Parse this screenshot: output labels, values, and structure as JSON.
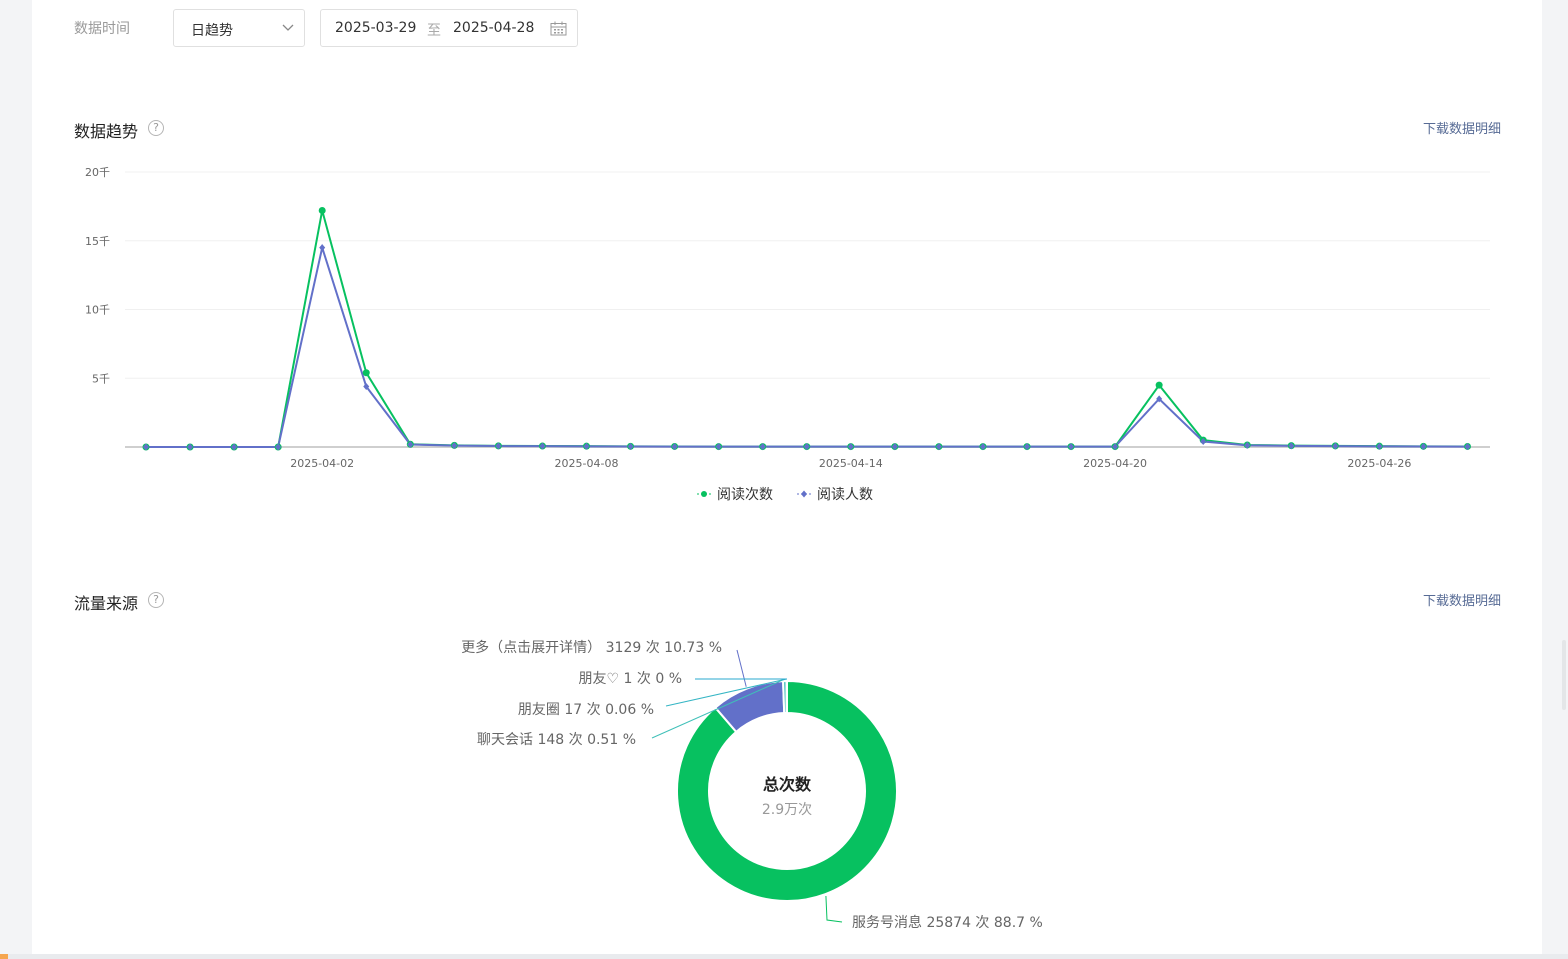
{
  "filters": {
    "label": "数据时间",
    "mode": "日趋势",
    "date_start": "2025-03-29",
    "date_sep": "至",
    "date_end": "2025-04-28"
  },
  "trend": {
    "title": "数据趋势",
    "help": "?",
    "download": "下载数据明细"
  },
  "source": {
    "title": "流量来源",
    "help": "?",
    "download": "下载数据明细",
    "center_title": "总次数",
    "center_value": "2.9万次"
  },
  "chart_data": [
    {
      "type": "line",
      "y_tick_labels": [
        "5千",
        "10千",
        "15千",
        "20千"
      ],
      "y_ticks": [
        5000,
        10000,
        15000,
        20000
      ],
      "ylim": [
        0,
        20000
      ],
      "x": [
        "2025-03-29",
        "2025-03-30",
        "2025-03-31",
        "2025-04-01",
        "2025-04-02",
        "2025-04-03",
        "2025-04-04",
        "2025-04-05",
        "2025-04-06",
        "2025-04-07",
        "2025-04-08",
        "2025-04-09",
        "2025-04-10",
        "2025-04-11",
        "2025-04-12",
        "2025-04-13",
        "2025-04-14",
        "2025-04-15",
        "2025-04-16",
        "2025-04-17",
        "2025-04-18",
        "2025-04-19",
        "2025-04-20",
        "2025-04-21",
        "2025-04-22",
        "2025-04-23",
        "2025-04-24",
        "2025-04-25",
        "2025-04-26",
        "2025-04-27",
        "2025-04-28"
      ],
      "x_tick_labels": [
        "2025-04-02",
        "2025-04-08",
        "2025-04-14",
        "2025-04-20",
        "2025-04-26"
      ],
      "series": [
        {
          "name": "阅读次数",
          "color": "#07c160",
          "marker": "circle",
          "values": [
            0,
            0,
            0,
            0,
            17200,
            5400,
            200,
            120,
            80,
            70,
            60,
            50,
            40,
            30,
            30,
            30,
            30,
            30,
            30,
            30,
            30,
            30,
            30,
            4500,
            500,
            150,
            100,
            80,
            60,
            50,
            40
          ]
        },
        {
          "name": "阅读人数",
          "color": "#6270c9",
          "marker": "diamond",
          "values": [
            0,
            0,
            0,
            0,
            14500,
            4400,
            180,
            100,
            70,
            60,
            50,
            40,
            30,
            25,
            25,
            25,
            25,
            25,
            25,
            25,
            25,
            25,
            25,
            3500,
            400,
            120,
            80,
            60,
            50,
            40,
            30
          ]
        }
      ],
      "legend_position": "bottom-center",
      "grid": true
    },
    {
      "type": "pie",
      "style": "donut",
      "slices": [
        {
          "label": "服务号消息 25874 次 88.7 %",
          "value": 25874,
          "percent": 88.7,
          "color": "#07c160"
        },
        {
          "label": "更多（点击展开详情） 3129 次 10.73 %",
          "value": 3129,
          "percent": 10.73,
          "color": "#6270c9"
        },
        {
          "label": "聊天会话 148 次 0.51 %",
          "value": 148,
          "percent": 0.51,
          "color": "#3fc0b8"
        },
        {
          "label": "朋友圈 17 次 0.06 %",
          "value": 17,
          "percent": 0.06,
          "color": "#34b5c4"
        },
        {
          "label": "朋友♡ 1 次 0 %",
          "value": 1,
          "percent": 0,
          "color": "#2aa8cf"
        }
      ]
    }
  ],
  "colors": {
    "accent": "#07c160",
    "secondary": "#6270c9",
    "link": "#576b95"
  }
}
